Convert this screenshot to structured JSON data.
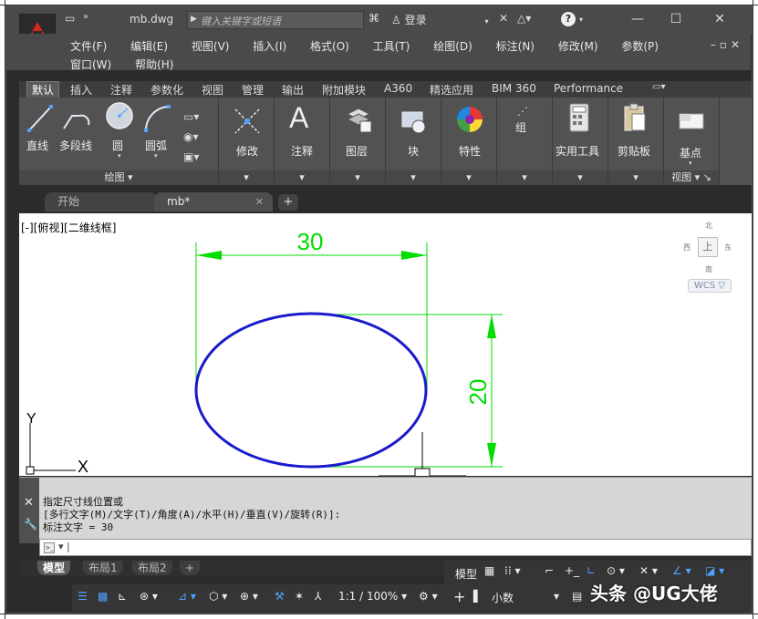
{
  "app": {
    "doc_title": "mb.dwg",
    "search_placeholder": "键入关键字或短语",
    "login_label": "登录"
  },
  "menu": {
    "row1": [
      "文件(F)",
      "编辑(E)",
      "视图(V)",
      "插入(I)",
      "格式(O)",
      "工具(T)",
      "绘图(D)",
      "标注(N)",
      "修改(M)",
      "参数(P)"
    ],
    "row2": [
      "窗口(W)",
      "帮助(H)"
    ]
  },
  "ribbon_tabs": [
    "默认",
    "插入",
    "注释",
    "参数化",
    "视图",
    "管理",
    "输出",
    "附加模块",
    "A360",
    "精选应用",
    "BIM 360",
    "Performance"
  ],
  "ribbon": {
    "draw_tools": [
      "直线",
      "多段线",
      "圆",
      "圆弧"
    ],
    "draw_panel": "绘图",
    "modify": "修改",
    "annotate": "注释",
    "layers": "图层",
    "block": "块",
    "properties": "特性",
    "group": "组",
    "utilities": "实用工具",
    "clipboard": "剪贴板",
    "basepoint": "基点",
    "view_panel": "视图"
  },
  "doc_tabs": {
    "start": "开始",
    "active": "mb*"
  },
  "viewport": {
    "label": "[-][俯视][二维线框]",
    "compass": {
      "n": "北",
      "w": "西",
      "e": "东",
      "s": "南",
      "top": "上"
    },
    "wcs": "WCS",
    "dim_horizontal": "30",
    "dim_vertical": "20",
    "ucs_x": "X",
    "ucs_y": "Y",
    "colors": {
      "ellipse": "#1a1acc",
      "dimension": "#00dd00"
    }
  },
  "command": {
    "lines": [
      "指定尺寸线位置或",
      "[多行文字(M)/文字(T)/角度(A)/水平(H)/垂直(V)/旋转(R)]:",
      "标注文字 = 30"
    ]
  },
  "layout_tabs": [
    "模型",
    "布局1",
    "布局2"
  ],
  "status": {
    "model": "模型",
    "scale": "1:1 / 100%",
    "units": "小数"
  },
  "watermark": "头条 @UG大佬"
}
